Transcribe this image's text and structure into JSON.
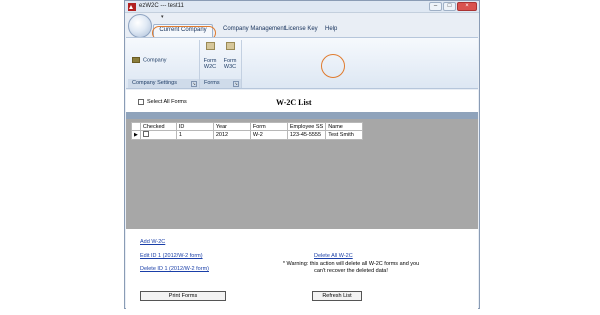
{
  "window": {
    "title": "ezW2C --- test11",
    "accent_color": "#e07b2e"
  },
  "ribbon": {
    "qat_arrow": "▾",
    "tabs": [
      {
        "label": "Current Company"
      },
      {
        "label": "Company Management"
      },
      {
        "label": "License Key"
      },
      {
        "label": "Help"
      }
    ],
    "groups": {
      "settings": {
        "label": "Company Settings",
        "company_button": "Company"
      },
      "forms": {
        "label": "Forms",
        "w2c_line1": "Form",
        "w2c_line2": "W2C",
        "w3c_line1": "Form",
        "w3c_line2": "W3C"
      }
    }
  },
  "list": {
    "select_all_label": "Select All Forms",
    "title": "W-2C List",
    "columns": [
      "Checked",
      "ID",
      "Year",
      "Form",
      "Employee SS",
      "Name"
    ],
    "rows": [
      {
        "id": "1",
        "year": "2012",
        "form": "W-2",
        "ss": "123-45-5555",
        "name": "Test Smith"
      }
    ]
  },
  "actions": {
    "add": "Add W-2C",
    "edit": "Edit ID 1 (2012/W-2 form)",
    "delete_id": "Delete ID 1 (2012/W-2 form)",
    "delete_all": "Delete All W-2C",
    "warning": "* Warning: this action will delete all W-2C forms and you can't recover the deleted data!",
    "print": "Print Forms",
    "refresh": "Refresh List"
  }
}
